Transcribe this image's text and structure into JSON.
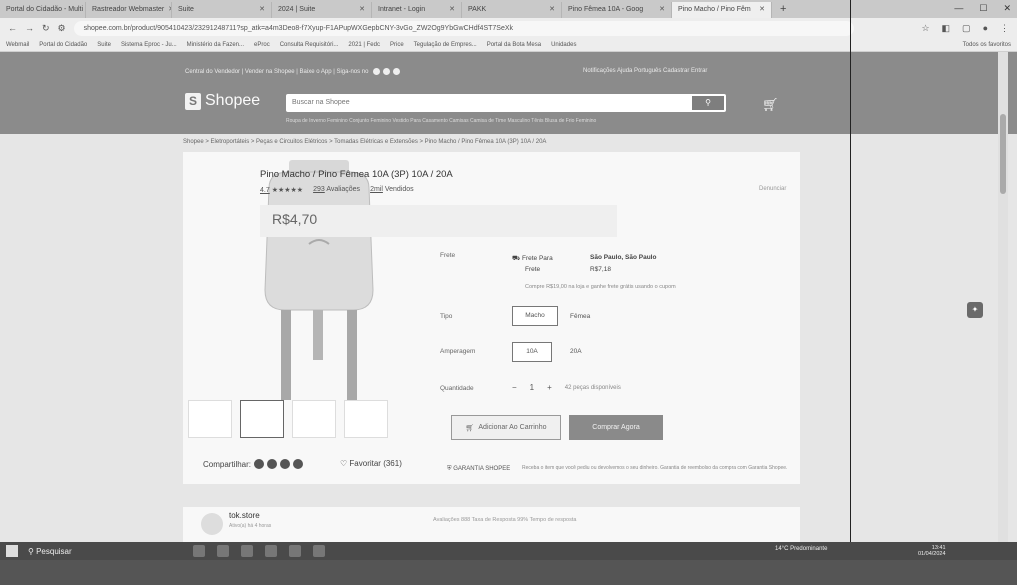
{
  "browser": {
    "tabs": [
      {
        "label": "Portal do Cidadão - Multi",
        "active": false
      },
      {
        "label": "Rastreador Webmaster",
        "active": false
      },
      {
        "label": "Suite",
        "active": false
      },
      {
        "label": "2024 | Suite",
        "active": false
      },
      {
        "label": "Intranet - Login",
        "active": false
      },
      {
        "label": "PAKK",
        "active": false
      },
      {
        "label": "Pino Fêmea 10A - Goog",
        "active": false
      },
      {
        "label": "Pino Macho / Pino Fêm",
        "active": true
      }
    ],
    "new_tab": "+",
    "url": "shopee.com.br/product/905410423/23291248711?sp_atk=a4m3Deo8-f7Xyup-F1APupWXGepbCNY-3vGo_ZW2Og9YbGwCHdf4ST7SeXk",
    "bookmarks": [
      "Webmail",
      "Portal do Cidadão",
      "Suite",
      "Sistema Eproc - Ju...",
      "Ministério da Fazen...",
      "eProc",
      "Consulta Requisitóri...",
      "2021 | Fedc",
      "Price",
      "Tegulação de Empres...",
      "Portal da Bota Mesa",
      "Unidades"
    ],
    "bookmarks_right": "Todos os favoritos"
  },
  "shopee": {
    "top_left": "Central do Vendedor | Vender na Shopee | Baixe o App | Siga-nos no",
    "top_right": "Notificações  Ajuda  Português  Cadastrar  Entrar",
    "brand": "Shopee",
    "search_placeholder": "Buscar na Shopee",
    "search_icon": "search-icon",
    "cart_icon": "cart-icon",
    "suggestions": "Roupa de Inverno Feminino  Conjunto Feminino  Vestido Para Casamento  Camisas  Camisa de Time Masculino  Tênis  Blusa de Frio Feminino",
    "breadcrumb": "Shopee > Eletroportáteis > Peças e Circuitos Elétricos > Tomadas Elétricas e Extensões > Pino Macho / Pino Fêmea 10A (3P) 10A / 20A",
    "product": {
      "title": "Pino Macho / Pino Fêmea 10A (3P) 10A / 20A",
      "rating": "4.7",
      "stars": "★★★★★",
      "reviews_count": "293",
      "reviews_label": "Avaliações",
      "sold_count": "2mil",
      "sold_label": "Vendidos",
      "report": "Denunciar",
      "price": "R$4,70",
      "shipping_label": "Frete",
      "shipping_line1": "Frete Para",
      "shipping_dest": "São Paulo, São Paulo",
      "shipping_line2": "Frete",
      "shipping_cost": "R$7,18",
      "shipping_promo": "Compre R$19,00 na loja e ganhe frete grátis usando o cupom",
      "type_label": "Tipo",
      "type_options": [
        "Macho",
        "Fêmea"
      ],
      "amperage_label": "Amperagem",
      "amperage_options": [
        "10A",
        "20A"
      ],
      "quantity_label": "Quantidade",
      "qty_minus": "−",
      "quantity": "1",
      "qty_plus": "+",
      "available": "42 peças disponíveis",
      "add_to_cart": "Adicionar Ao Carrinho",
      "buy_now": "Comprar Agora",
      "share_label": "Compartilhar:",
      "favorite_label": "Favoritar (361)",
      "guarantee_title": "GARANTIA SHOPEE",
      "guarantee_text": "Receba o item que você pediu ou devolvemos o seu dinheiro. Garantia de reembolso da compra com Garantia Shopee."
    },
    "store": {
      "name": "tok.store",
      "status": "Ativo(a) há 4 horas",
      "stats": "Avaliações  888    Taxa de Resposta  99%    Tempo de resposta"
    }
  },
  "taskbar": {
    "search": "Pesquisar",
    "weather": "14°C  Predominante",
    "time": "13:41",
    "date": "01/04/2024"
  }
}
